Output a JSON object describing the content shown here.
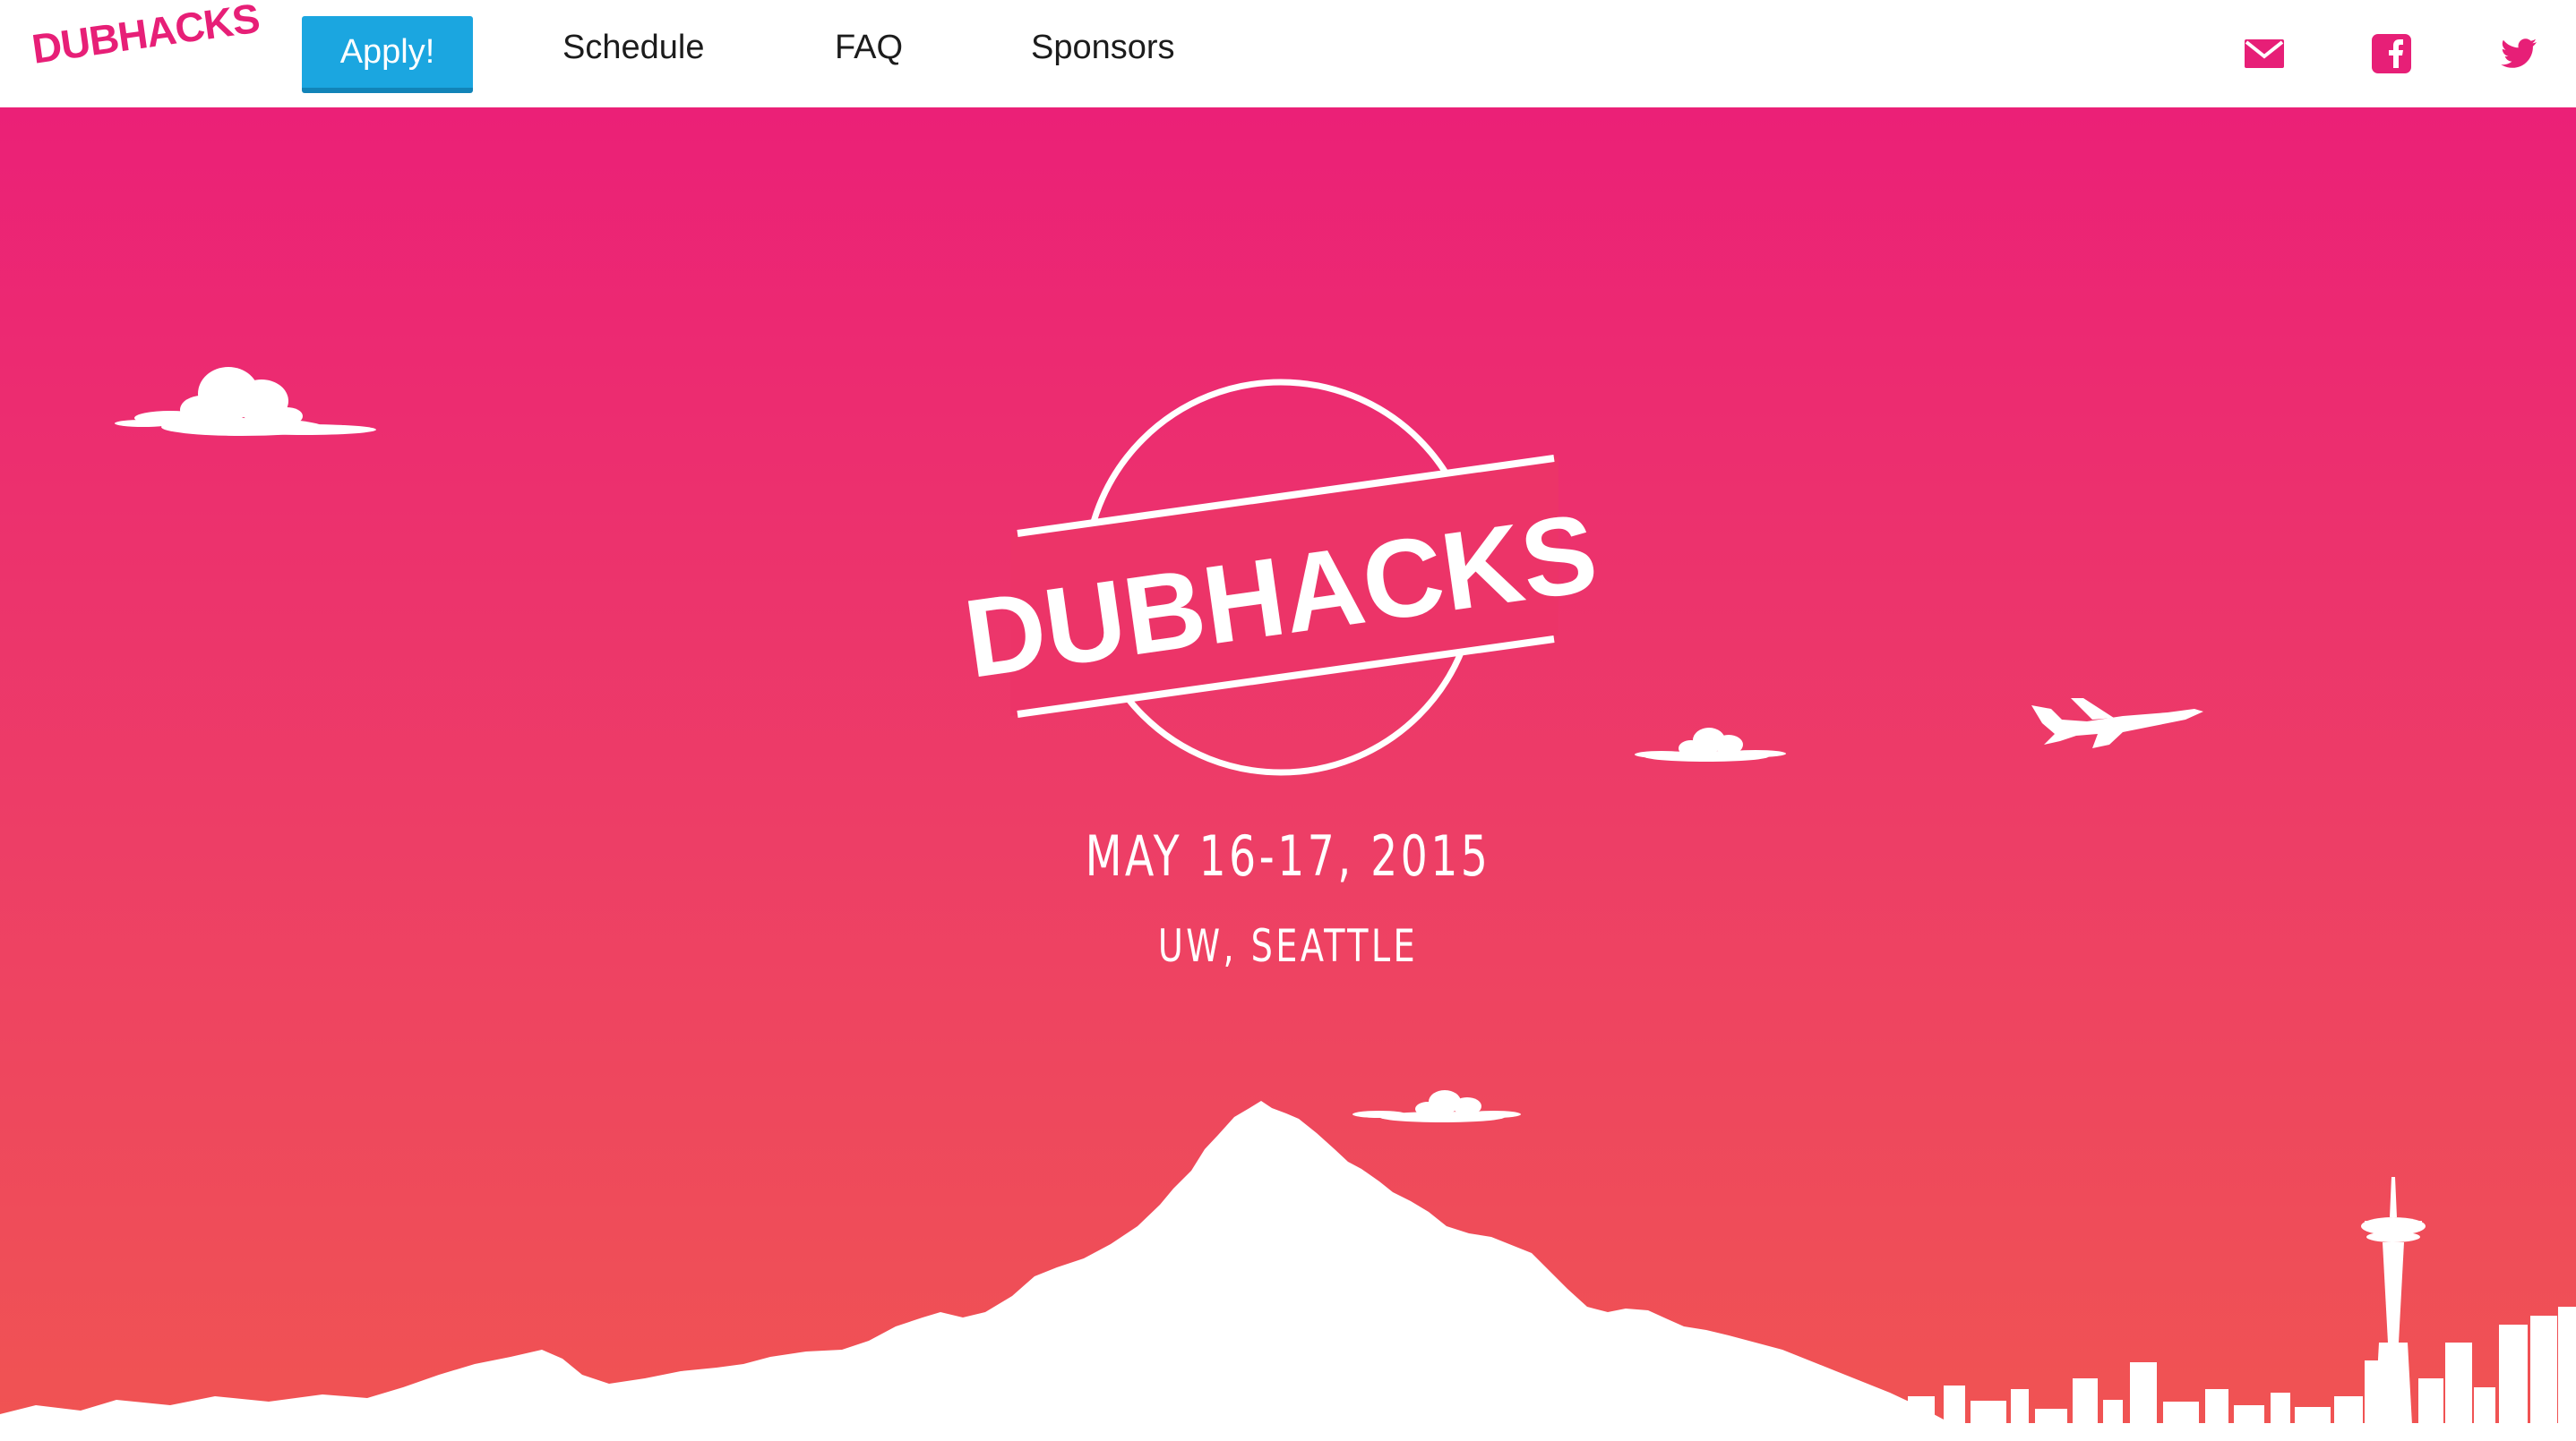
{
  "nav": {
    "logo": "DUBHACKS",
    "apply_label": "Apply!",
    "links": [
      {
        "label": "Schedule"
      },
      {
        "label": "FAQ"
      },
      {
        "label": "Sponsors"
      }
    ],
    "social": [
      {
        "icon": "mail-icon"
      },
      {
        "icon": "facebook-icon"
      },
      {
        "icon": "twitter-icon"
      }
    ]
  },
  "hero": {
    "badge_title": "DUBHACKS",
    "date": "MAY 16-17, 2015",
    "location": "UW, SEATTLE"
  },
  "colors": {
    "brand_pink": "#e71f77",
    "apply_blue": "#1ba6e0",
    "gradient_top": "#eb2077",
    "gradient_bottom": "#f05452"
  }
}
